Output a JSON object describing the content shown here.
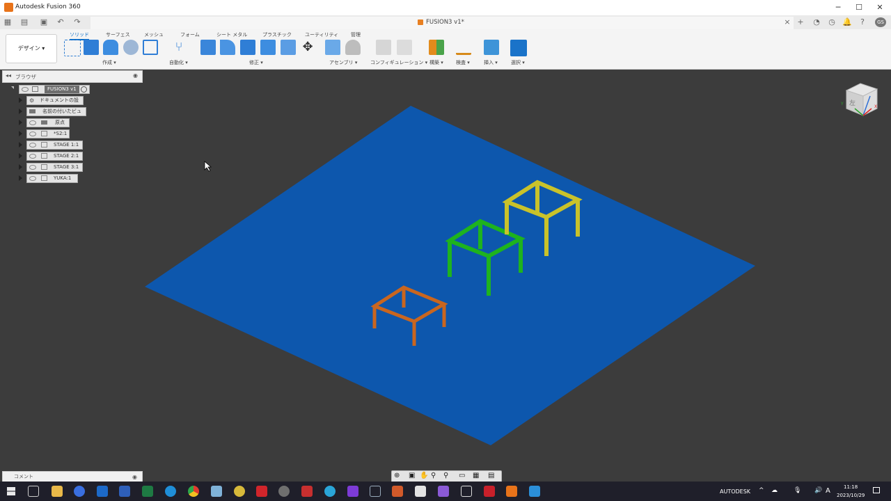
{
  "window": {
    "title": "Autodesk Fusion 360",
    "minimize": "─",
    "maximize": "☐",
    "close": "✕"
  },
  "doc_tab": {
    "title": "FUSION3 v1*",
    "close": "×",
    "add": "+"
  },
  "toolbar": {
    "design_menu": "デザイン ▾",
    "tabs": [
      "ソリッド",
      "サーフェス",
      "メッシュ",
      "フォーム",
      "シート メタル",
      "プラスチック",
      "ユーティリティ",
      "管理"
    ],
    "active_tab": "ソリッド",
    "groups": [
      "作成 ▾",
      "自動化 ▾",
      "修正 ▾",
      "アセンブリ ▾",
      "コンフィギュレーション ▾",
      "構築 ▾",
      "検査 ▾",
      "挿入 ▾",
      "選択 ▾"
    ]
  },
  "browser": {
    "header": "ブラウザ",
    "root": "FUSION3 v1",
    "items": [
      {
        "label": "ドキュメントの設定",
        "icon": "gear-icon"
      },
      {
        "label": "名前の付いたビュー",
        "icon": "folder-icon"
      },
      {
        "label": "原点",
        "icon": "folder-icon"
      },
      {
        "label": "*S2:1",
        "icon": "component-icon"
      },
      {
        "label": "STAGE 1:1",
        "icon": "component-icon"
      },
      {
        "label": "STAGE 2:1",
        "icon": "component-icon"
      },
      {
        "label": "STAGE 3:1",
        "icon": "component-icon"
      },
      {
        "label": "YUKA:1",
        "icon": "component-icon"
      }
    ]
  },
  "comments": {
    "label": "コメント"
  },
  "viewcube": {
    "face": "左",
    "axis_y": "Y",
    "axis_x": "X"
  },
  "tray": {
    "brand": "AUTODESK",
    "time": "11:18",
    "date": "2023/10/29",
    "ime": "A"
  },
  "colors": {
    "floor": "#0d57ad",
    "stage1": "#c9661f",
    "stage2": "#1eb31e",
    "stage3": "#c9c22a",
    "canvas": "#3c3c3c"
  }
}
